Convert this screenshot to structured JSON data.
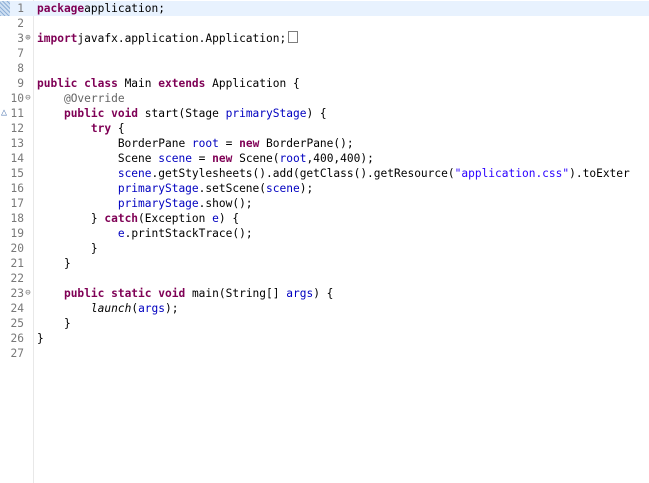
{
  "editor": {
    "lines": [
      {
        "n": "1",
        "current": true,
        "segments": [
          [
            "kw",
            "package"
          ],
          [
            "",
            "application;"
          ]
        ]
      },
      {
        "n": "2",
        "segments": []
      },
      {
        "n": "3",
        "fold": "plus",
        "segments": [
          [
            "kw",
            "import"
          ],
          [
            "",
            "javafx.application.Application;"
          ]
        ],
        "folded": true
      },
      {
        "n": "7",
        "segments": []
      },
      {
        "n": "8",
        "segments": []
      },
      {
        "n": "9",
        "segments": [
          [
            "kw",
            "public class"
          ],
          [
            "",
            " Main "
          ],
          [
            "kw",
            "extends"
          ],
          [
            "",
            " Application {"
          ]
        ]
      },
      {
        "n": "10",
        "fold": "minus",
        "segments": [
          [
            "",
            "    "
          ],
          [
            "ann",
            "@Override"
          ]
        ]
      },
      {
        "n": "11",
        "override": true,
        "segments": [
          [
            "",
            "    "
          ],
          [
            "kw",
            "public void"
          ],
          [
            "",
            " start(Stage "
          ],
          [
            "fld",
            "primaryStage"
          ],
          [
            "",
            ") {"
          ]
        ]
      },
      {
        "n": "12",
        "segments": [
          [
            "",
            "        "
          ],
          [
            "kw",
            "try"
          ],
          [
            "",
            " {"
          ]
        ]
      },
      {
        "n": "13",
        "segments": [
          [
            "",
            "            BorderPane "
          ],
          [
            "fld",
            "root"
          ],
          [
            "",
            " = "
          ],
          [
            "kw",
            "new"
          ],
          [
            "",
            " BorderPane();"
          ]
        ]
      },
      {
        "n": "14",
        "segments": [
          [
            "",
            "            Scene "
          ],
          [
            "fld",
            "scene"
          ],
          [
            "",
            " = "
          ],
          [
            "kw",
            "new"
          ],
          [
            "",
            " Scene("
          ],
          [
            "fld",
            "root"
          ],
          [
            "",
            ",400,400);"
          ]
        ]
      },
      {
        "n": "15",
        "segments": [
          [
            "",
            "            "
          ],
          [
            "fld",
            "scene"
          ],
          [
            "",
            ".getStylesheets().add(getClass().getResource("
          ],
          [
            "str",
            "\"application.css\""
          ],
          [
            "",
            ").toExter"
          ]
        ]
      },
      {
        "n": "16",
        "segments": [
          [
            "",
            "            "
          ],
          [
            "fld",
            "primaryStage"
          ],
          [
            "",
            ".setScene("
          ],
          [
            "fld",
            "scene"
          ],
          [
            "",
            ");"
          ]
        ]
      },
      {
        "n": "17",
        "segments": [
          [
            "",
            "            "
          ],
          [
            "fld",
            "primaryStage"
          ],
          [
            "",
            ".show();"
          ]
        ]
      },
      {
        "n": "18",
        "segments": [
          [
            "",
            "        } "
          ],
          [
            "kw",
            "catch"
          ],
          [
            "",
            "(Exception "
          ],
          [
            "fld",
            "e"
          ],
          [
            "",
            ") {"
          ]
        ]
      },
      {
        "n": "19",
        "segments": [
          [
            "",
            "            "
          ],
          [
            "fld",
            "e"
          ],
          [
            "",
            ".printStackTrace();"
          ]
        ]
      },
      {
        "n": "20",
        "segments": [
          [
            "",
            "        }"
          ]
        ]
      },
      {
        "n": "21",
        "segments": [
          [
            "",
            "    }"
          ]
        ]
      },
      {
        "n": "22",
        "segments": []
      },
      {
        "n": "23",
        "fold": "minus",
        "segments": [
          [
            "",
            "    "
          ],
          [
            "kw",
            "public static void"
          ],
          [
            "",
            " main(String[] "
          ],
          [
            "fld",
            "args"
          ],
          [
            "",
            ") {"
          ]
        ]
      },
      {
        "n": "24",
        "segments": [
          [
            "",
            "        "
          ],
          [
            "ital",
            "launch"
          ],
          [
            "",
            "("
          ],
          [
            "fld",
            "args"
          ],
          [
            "",
            ");"
          ]
        ]
      },
      {
        "n": "25",
        "segments": [
          [
            "",
            "    }"
          ]
        ]
      },
      {
        "n": "26",
        "segments": [
          [
            "",
            "}"
          ]
        ]
      },
      {
        "n": "27",
        "segments": []
      }
    ]
  }
}
